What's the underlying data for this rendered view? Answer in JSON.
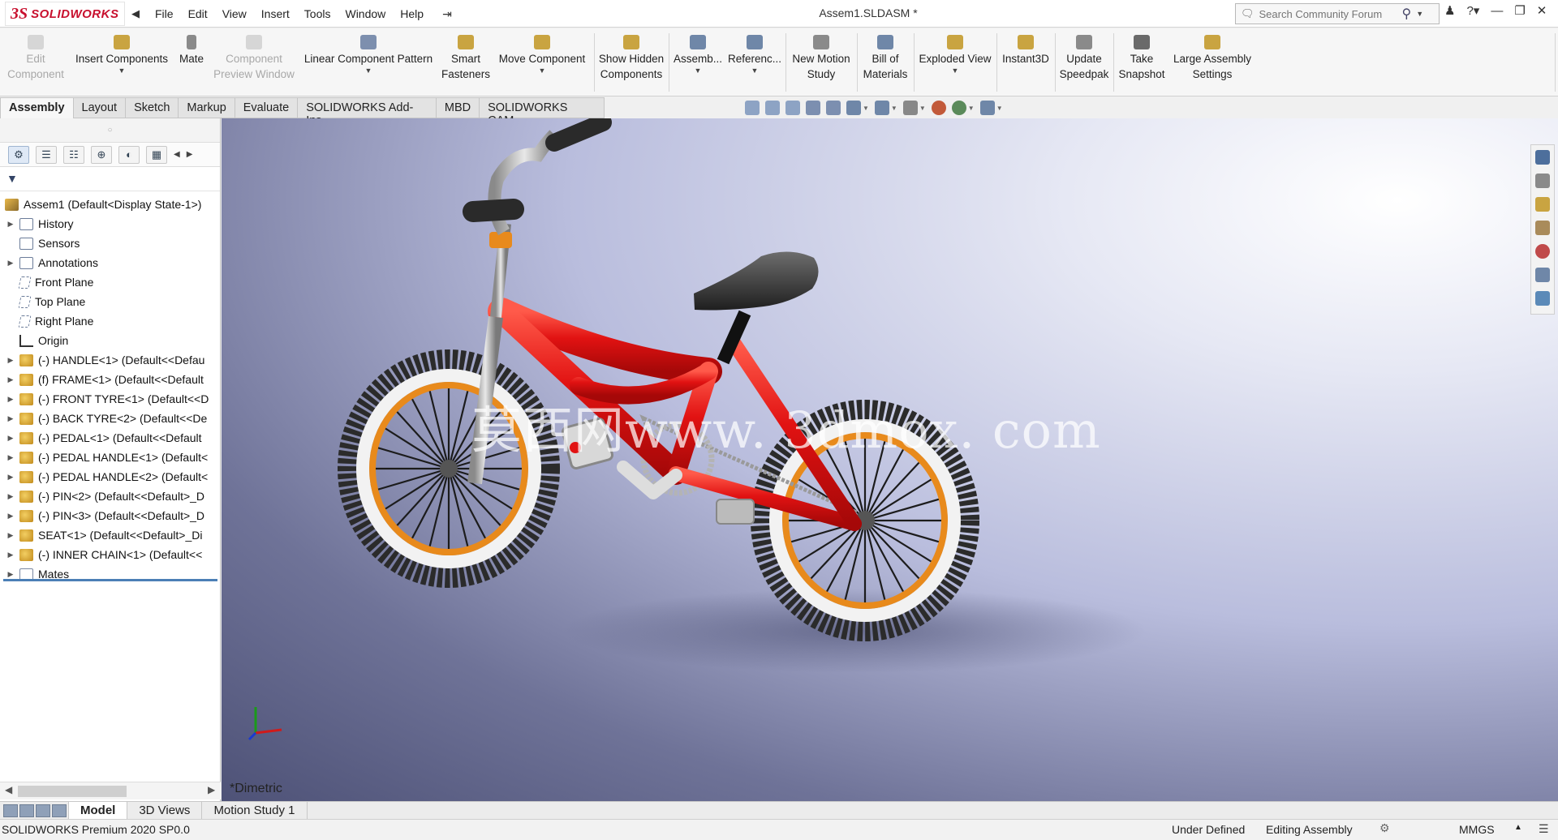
{
  "app": {
    "brand": "SOLIDWORKS",
    "document_title": "Assem1.SLDASM *",
    "menu": [
      "File",
      "Edit",
      "View",
      "Insert",
      "Tools",
      "Window",
      "Help"
    ],
    "search_placeholder": "Search Community Forum"
  },
  "commands": {
    "edit_component": [
      "Edit",
      "Component"
    ],
    "insert_components": "Insert Components",
    "mate": "Mate",
    "component_preview_window": [
      "Component",
      "Preview Window"
    ],
    "linear_component_pattern": "Linear Component Pattern",
    "smart_fasteners": [
      "Smart",
      "Fasteners"
    ],
    "move_component": "Move Component",
    "show_hidden_components": [
      "Show Hidden",
      "Components"
    ],
    "assembly": "Assemb...",
    "reference": "Referenc...",
    "new_motion_study": [
      "New Motion",
      "Study"
    ],
    "bill_of_materials": [
      "Bill of",
      "Materials"
    ],
    "exploded_view": "Exploded View",
    "instant3d": "Instant3D",
    "update_speedpak": [
      "Update",
      "Speedpak"
    ],
    "take_snapshot": [
      "Take",
      "Snapshot"
    ],
    "large_assembly_settings": [
      "Large Assembly",
      "Settings"
    ]
  },
  "command_tabs": [
    "Assembly",
    "Layout",
    "Sketch",
    "Markup",
    "Evaluate",
    "SOLIDWORKS Add-Ins",
    "MBD",
    "SOLIDWORKS CAM"
  ],
  "tree": {
    "root": "Assem1  (Default<Display State-1>)",
    "items": [
      {
        "label": "History",
        "icon": "history-icon",
        "expandable": true
      },
      {
        "label": "Sensors",
        "icon": "sensors-icon",
        "expandable": false
      },
      {
        "label": "Annotations",
        "icon": "annotations-icon",
        "expandable": true
      },
      {
        "label": "Front Plane",
        "icon": "plane-icon",
        "expandable": false
      },
      {
        "label": "Top Plane",
        "icon": "plane-icon",
        "expandable": false
      },
      {
        "label": "Right Plane",
        "icon": "plane-icon",
        "expandable": false
      },
      {
        "label": "Origin",
        "icon": "origin-icon",
        "expandable": false
      },
      {
        "label": "(-) HANDLE<1> (Default<<Defau",
        "icon": "part-icon",
        "expandable": true
      },
      {
        "label": "(f) FRAME<1> (Default<<Default",
        "icon": "part-icon",
        "expandable": true
      },
      {
        "label": "(-) FRONT TYRE<1> (Default<<D",
        "icon": "part-icon",
        "expandable": true
      },
      {
        "label": "(-) BACK TYRE<2> (Default<<De",
        "icon": "part-icon",
        "expandable": true
      },
      {
        "label": "(-) PEDAL<1> (Default<<Default",
        "icon": "part-icon",
        "expandable": true
      },
      {
        "label": "(-) PEDAL HANDLE<1> (Default<",
        "icon": "part-icon",
        "expandable": true
      },
      {
        "label": "(-) PEDAL HANDLE<2> (Default<",
        "icon": "part-icon",
        "expandable": true
      },
      {
        "label": "(-) PIN<2> (Default<<Default>_D",
        "icon": "part-icon",
        "expandable": true
      },
      {
        "label": "(-) PIN<3> (Default<<Default>_D",
        "icon": "part-icon",
        "expandable": true
      },
      {
        "label": "SEAT<1> (Default<<Default>_Di",
        "icon": "part-icon",
        "expandable": true
      },
      {
        "label": "(-) INNER CHAIN<1> (Default<<",
        "icon": "part-icon",
        "expandable": true
      },
      {
        "label": "Mates",
        "icon": "mates-icon",
        "expandable": true
      }
    ]
  },
  "graphics": {
    "watermark": "莫西网www. 3dmox. com",
    "view_orientation": "*Dimetric"
  },
  "bottom_tabs": [
    "Model",
    "3D Views",
    "Motion Study 1"
  ],
  "status": {
    "product": "SOLIDWORKS Premium 2020 SP0.0",
    "state": "Under Defined",
    "mode": "Editing Assembly",
    "units": "MMGS"
  },
  "colors": {
    "brand_red": "#c8102e",
    "frame_red": "#e01010",
    "rim_orange": "#e88a1c",
    "tree_accent": "#4b7fb6"
  }
}
